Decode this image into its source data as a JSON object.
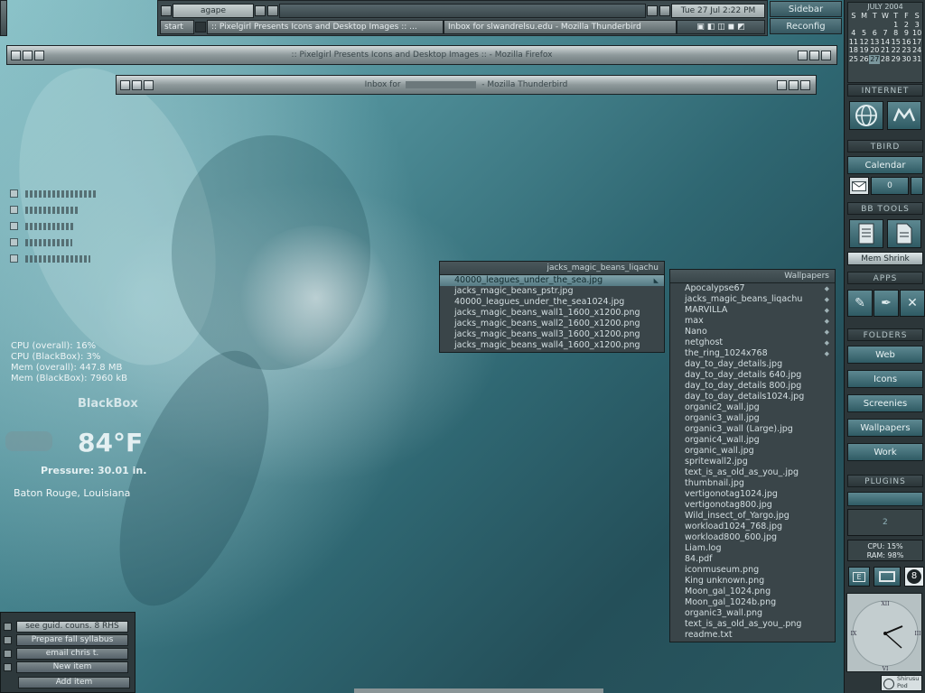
{
  "taskbar": {
    "workspace": "agape",
    "clock": "Tue 27 Jul 2:22 PM",
    "start_label": "start",
    "tasks": [
      ":: Pixelgirl Presents Icons and Desktop Images :: ...",
      "Inbox for slwandrelsu.edu - Mozilla Thunderbird"
    ]
  },
  "system_buttons": {
    "sidebar": "Sidebar",
    "reconfig": "Reconfig"
  },
  "windows": [
    {
      "title": ":: Pixelgirl Presents Icons and Desktop Images :: - Mozilla Firefox"
    },
    {
      "title_prefix": "Inbox for",
      "title_suffix": "- Mozilla Thunderbird"
    }
  ],
  "system_stats": {
    "cpu_overall": "CPU (overall): 16%",
    "cpu_blackbox": "CPU (BlackBox): 3%",
    "mem_overall": "Mem (overall): 447.8 MB",
    "mem_blackbox": "Mem (BlackBox): 7960 kB"
  },
  "weather": {
    "title": "BlackBox",
    "temperature": "84°F",
    "pressure": "Pressure:  30.01 in.",
    "location": "Baton Rouge, Louisiana"
  },
  "todo": {
    "items": [
      "see guid. couns. 8 RHS",
      "Prepare fall syllabus",
      "email chris t.",
      "New item"
    ],
    "add_label": "Add item"
  },
  "menu_small": {
    "title": "jacks_magic_beans_liqachu",
    "items": [
      "40000_leagues_under_the_sea.jpg",
      "jacks_magic_beans_pstr.jpg",
      "40000_leagues_under_the_sea1024.jpg",
      "jacks_magic_beans_wall1_1600_x1200.png",
      "jacks_magic_beans_wall2_1600_x1200.png",
      "jacks_magic_beans_wall3_1600_x1200.png",
      "jacks_magic_beans_wall4_1600_x1200.png"
    ]
  },
  "menu_wallpapers": {
    "title": "Wallpapers",
    "submenus": [
      "Apocalypse67",
      "jacks_magic_beans_liqachu",
      "MARVILLA",
      "max",
      "Nano",
      "netghost",
      "the_ring_1024x768"
    ],
    "files": [
      "day_to_day_details.jpg",
      "day_to_day_details 640.jpg",
      "day_to_day_details 800.jpg",
      "day_to_day_details1024.jpg",
      "organic2_wall.jpg",
      "organic3_wall.jpg",
      "organic3_wall (Large).jpg",
      "organic4_wall.jpg",
      "organic_wall.jpg",
      "spritewall2.jpg",
      "text_is_as_old_as_you_.jpg",
      "thumbnail.jpg",
      "vertigonotag1024.jpg",
      "vertigonotag800.jpg",
      "Wild_insect_of_Yargo.jpg",
      "workload1024_768.jpg",
      "workload800_600.jpg",
      "Liam.log",
      "84.pdf",
      "iconmuseum.png",
      "King unknown.png",
      "Moon_gal_1024.png",
      "Moon_gal_1024b.png",
      "organic3_wall.png",
      "text_is_as_old_as_you_.png",
      "readme.txt"
    ]
  },
  "calendar": {
    "month": "JULY 2004",
    "weekdays": [
      "S",
      "M",
      "T",
      "W",
      "T",
      "F",
      "S"
    ],
    "days": [
      "",
      "",
      "",
      "",
      "1",
      "2",
      "3",
      "4",
      "5",
      "6",
      "7",
      "8",
      "9",
      "10",
      "11",
      "12",
      "13",
      "14",
      "15",
      "16",
      "17",
      "18",
      "19",
      "20",
      "21",
      "22",
      "23",
      "24",
      "25",
      "26",
      "27",
      "28",
      "29",
      "30",
      "31"
    ],
    "today": "27"
  },
  "slit": {
    "internet": "INTERNET",
    "tbird": "TBIRD",
    "calendar_btn": "Calendar",
    "mail_count": "0",
    "bb_tools": "BB TOOLS",
    "mem_shrink": "Mem Shrink",
    "apps": "APPS",
    "folders": "FOLDERS",
    "folder_items": [
      "Web",
      "Icons",
      "Screenies",
      "Wallpapers",
      "Work"
    ],
    "plugins": "PLUGINS",
    "cpu_usage": "CPU: 15%",
    "ram_usage": "RAM: 98%",
    "pager_current": "2",
    "eight_ball": "8",
    "e_label": "E",
    "clock_numerals": {
      "twelve": "XII",
      "three": "III",
      "six": "VI",
      "nine": "IX"
    },
    "pod_label_1": "Shirusu",
    "pod_label_2": "Pod"
  },
  "colors": {
    "accent": "#5d8891",
    "menu_bg": "#3a4549",
    "wallpaper_dark": "#244f59"
  }
}
